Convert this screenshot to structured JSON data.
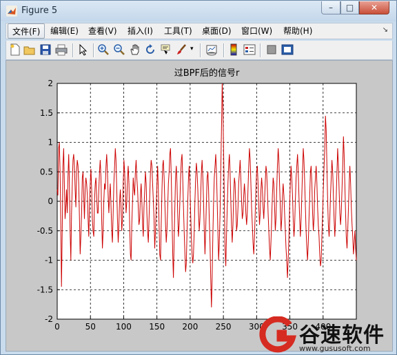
{
  "window": {
    "title": "Figure 5",
    "controls": {
      "minimize": "–",
      "maximize": "□",
      "close": "✕"
    }
  },
  "menu": {
    "items": [
      "文件(F)",
      "编辑(E)",
      "查看(V)",
      "插入(I)",
      "工具(T)",
      "桌面(D)",
      "窗口(W)",
      "帮助(H)"
    ],
    "overflow_arrow": "↘"
  },
  "toolbar": {
    "icons": [
      "new-figure-icon",
      "open-file-icon",
      "save-icon",
      "print-icon",
      "edit-plot-icon",
      "zoom-in-icon",
      "zoom-out-icon",
      "pan-icon",
      "rotate-3d-icon",
      "data-cursor-icon",
      "brush-icon",
      "link-plot-icon",
      "colorbar-icon",
      "legend-icon",
      "hide-plot-tools-icon",
      "show-plot-tools-icon"
    ]
  },
  "chart_data": {
    "type": "line",
    "title": "过BPF后的信号r",
    "xlabel": "",
    "ylabel": "",
    "xlim": [
      0,
      450
    ],
    "ylim": [
      -2,
      2
    ],
    "grid": true,
    "line_color": "#cc0000",
    "xticks": [
      "0",
      "50",
      "100",
      "150",
      "200",
      "250",
      "300",
      "350",
      "400"
    ],
    "yticks": [
      "2",
      "1.5",
      "1",
      "0.5",
      "0",
      "-0.5",
      "-1",
      "-1.5",
      "-2"
    ],
    "y": [
      0.2,
      0.1,
      0.9,
      1.0,
      0.5,
      -0.4,
      -1.45,
      -0.5,
      0.6,
      0.9,
      0.3,
      -0.3,
      -0.1,
      0.2,
      -0.2,
      0.4,
      0.8,
      0.3,
      -0.5,
      -1.0,
      -0.2,
      0.3,
      0.7,
      0.8,
      0.6,
      0.2,
      -0.1,
      0.5,
      0.7,
      0.6,
      0.3,
      -0.3,
      -0.9,
      -0.6,
      -0.2,
      0.4,
      0.5,
      0.1,
      -0.3,
      0.2,
      0.4,
      0.3,
      0.1,
      -0.3,
      -0.6,
      -0.1,
      0.3,
      0.55,
      0.2,
      -0.3,
      -0.5,
      -0.6,
      0.0,
      0.3,
      0.4,
      0.1,
      -0.2,
      -0.2,
      0.2,
      0.5,
      0.7,
      0.4,
      -0.3,
      -0.8,
      -0.5,
      0.0,
      0.3,
      0.2,
      0.6,
      0.8,
      0.5,
      0.1,
      -0.2,
      0.1,
      0.3,
      -0.1,
      -0.5,
      -0.7,
      -0.2,
      0.3,
      0.6,
      0.9,
      0.7,
      0.2,
      -0.3,
      -0.7,
      -0.4,
      0.0,
      0.2,
      -0.1,
      -0.5,
      -0.3,
      0.3,
      0.7,
      0.5,
      0.2,
      -0.2,
      0.0,
      0.4,
      0.6,
      0.3,
      -0.4,
      -0.9,
      -1.0,
      -0.4,
      0.0,
      0.4,
      0.2,
      0.1,
      0.5,
      0.7,
      0.4,
      0.2,
      -0.1,
      -0.4,
      -0.3,
      0.1,
      0.3,
      0.0,
      -0.4,
      -0.6,
      -0.1,
      0.2,
      0.5,
      0.3,
      -0.2,
      -0.5,
      -0.7,
      -0.3,
      0.1,
      0.5,
      0.7,
      0.6,
      0.3,
      0.0,
      -0.3,
      -0.8,
      -0.5,
      -0.1,
      0.3,
      0.6,
      0.2,
      -0.4,
      -0.9,
      -1.0,
      -0.4,
      0.2,
      0.6,
      0.7,
      0.4,
      0.0,
      -0.4,
      -0.7,
      -0.5,
      -0.1,
      0.3,
      0.5,
      0.8,
      0.9,
      0.4,
      -0.2,
      -0.9,
      -1.3,
      -0.7,
      -0.1,
      0.4,
      0.6,
      0.3,
      -0.2,
      -0.6,
      -0.4,
      0.0,
      0.4,
      0.7,
      0.8,
      0.4,
      -0.1,
      -0.5,
      -0.9,
      -1.2,
      -1.05,
      -0.5,
      0.0,
      0.4,
      0.6,
      0.3,
      -0.2,
      -0.6,
      -0.9,
      -1.05,
      -0.9,
      -0.5,
      0.0,
      0.4,
      0.65,
      0.5,
      0.2,
      -0.2,
      -0.5,
      -0.3,
      0.1,
      0.5,
      0.7,
      0.4,
      0.0,
      -0.5,
      -0.9,
      -0.5,
      0.0,
      0.4,
      0.5,
      0.2,
      -0.3,
      -0.7,
      -1.3,
      -1.8,
      -1.3,
      -0.6,
      0.0,
      0.4,
      0.6,
      0.8,
      0.5,
      0.0,
      -0.5,
      -1.0,
      -0.7,
      -0.2,
      0.5,
      1.2,
      2.0,
      1.6,
      0.8,
      0.0,
      -0.8,
      -1.1,
      -0.6,
      -0.1,
      0.3,
      0.6,
      0.8,
      0.5,
      0.0,
      -0.4,
      -0.7,
      -0.4,
      0.1,
      0.4,
      0.3,
      -0.1,
      -0.5,
      -0.4,
      -0.1,
      0.3,
      0.5,
      0.7,
      0.4,
      0.0,
      -0.3,
      -0.2,
      0.1,
      0.3,
      0.1,
      -0.2,
      -0.4,
      -0.2,
      0.2,
      0.6,
      0.9,
      0.7,
      0.3,
      -0.1,
      -0.4,
      -0.7,
      -0.9,
      -0.6,
      -0.2,
      0.2,
      0.5,
      0.6,
      0.3,
      -0.1,
      -0.4,
      -0.2,
      0.2,
      0.4,
      0.2,
      -0.1,
      -0.3,
      0.0,
      0.3,
      0.6,
      0.5,
      0.2,
      -0.2,
      -0.5,
      -0.8,
      -1.0,
      -0.7,
      -0.3,
      0.1,
      0.4,
      0.3,
      -0.1,
      -0.5,
      -0.3,
      0.2,
      0.6,
      0.9,
      0.7,
      0.3,
      -0.1,
      -0.5,
      -0.3,
      0.1,
      0.3,
      0.1,
      -0.2,
      -0.5,
      -0.8,
      -1.0,
      -1.3,
      -1.0,
      -0.6,
      -0.1,
      0.3,
      0.6,
      0.4,
      0.1,
      -0.3,
      -0.6,
      -0.4,
      0.0,
      0.4,
      0.6,
      0.8,
      0.5,
      0.1,
      -0.3,
      -0.6,
      -0.3,
      0.1,
      0.5,
      0.9,
      0.7,
      0.3,
      -0.1,
      -0.5,
      -0.8,
      -1.0,
      -0.7,
      -0.3,
      0.1,
      0.5,
      0.6,
      0.3,
      -0.2,
      -0.5,
      -0.3,
      0.2,
      0.4,
      0.6,
      0.3,
      -0.1,
      -0.4,
      -0.6,
      -0.9,
      -1.1,
      -1.0,
      -0.6,
      -0.2,
      0.2,
      0.6,
      0.9,
      1.45,
      1.2,
      0.6,
      0.0,
      -0.4,
      -0.6,
      -0.3,
      0.1,
      0.4,
      0.7,
      0.5,
      0.1,
      -0.3,
      -0.6,
      -0.3,
      0.1,
      0.5,
      0.9,
      0.6,
      0.2,
      -0.2,
      -0.4,
      -0.2,
      0.2,
      0.6,
      1.1,
      0.8,
      0.3,
      -0.2,
      -0.6,
      -0.8,
      -0.5,
      -0.1,
      0.3,
      0.6,
      0.3,
      -0.1,
      -0.4,
      -0.6,
      -0.9,
      -0.7,
      -0.5,
      -0.8,
      -1.0
    ]
  },
  "watermark": {
    "brand": "谷速软件",
    "url": "www.gususoft.com"
  }
}
